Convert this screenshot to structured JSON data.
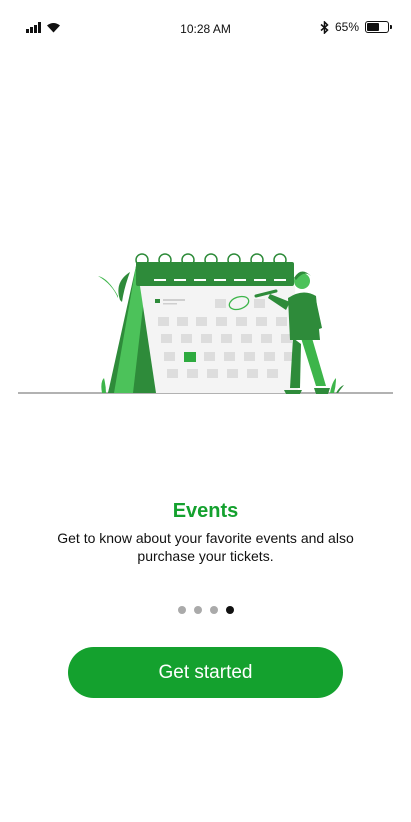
{
  "status": {
    "time": "10:28 AM",
    "battery_text": "65%",
    "battery_level": 0.65
  },
  "onboarding": {
    "title": "Events",
    "subtitle": "Get to know about your favorite events and also purchase your tickets.",
    "pages_total": 4,
    "active_page": 4,
    "cta_label": "Get started"
  },
  "theme": {
    "accent": "#14A12E",
    "accent_dark": "#2E8B3A",
    "accent_light": "#4CC25A",
    "dot_inactive": "#AAAAAA",
    "dot_active": "#111111"
  },
  "icons": [
    "signal-icon",
    "wifi-icon",
    "bluetooth-icon",
    "battery-icon"
  ]
}
